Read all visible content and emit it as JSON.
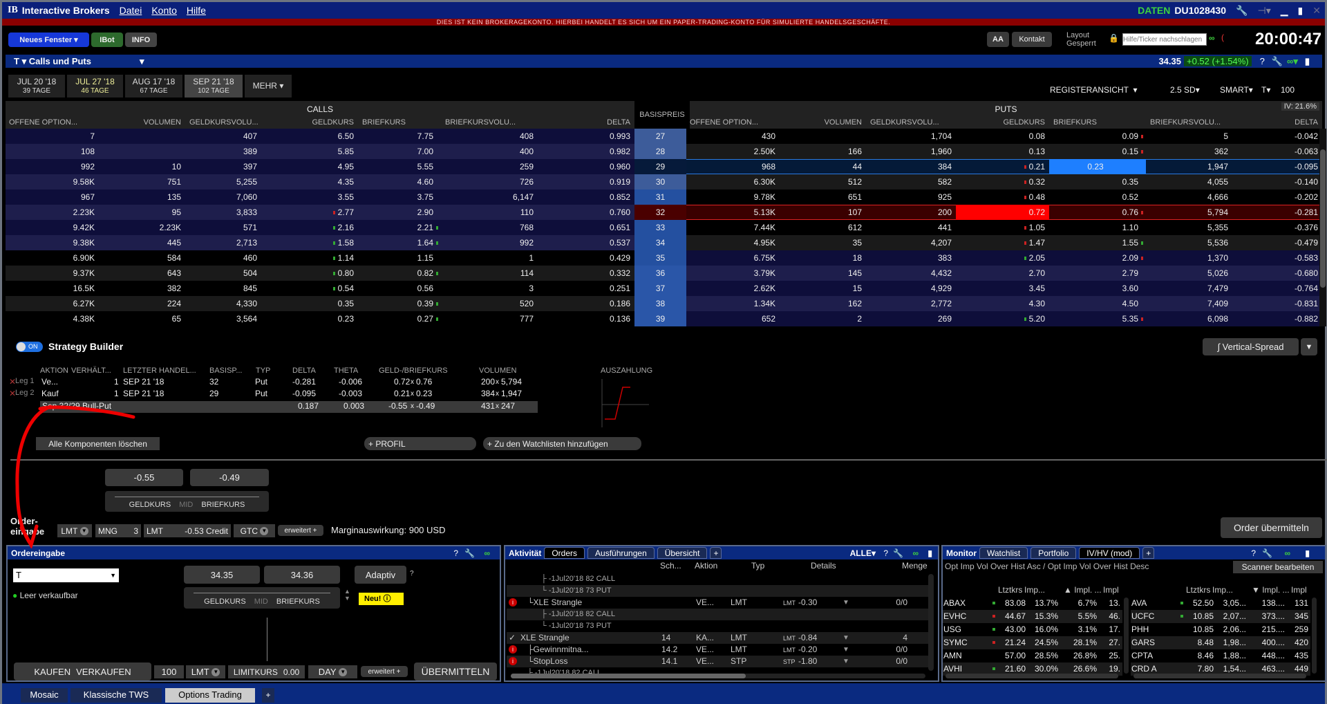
{
  "app": {
    "logo": "IB",
    "title": "Interactive Brokers",
    "menu": [
      "Datei",
      "Konto",
      "Hilfe"
    ],
    "data_label": "DATEN",
    "account": "DU1028430"
  },
  "banner": "DIES IST KEIN BROKERAGEKONTO. HIERBEI HANDELT ES SICH UM EIN PAPER-TRADING-KONTO FÜR SIMULIERTE HANDELSGESCHÄFTE.",
  "toolbar": {
    "new_window": "Neues Fenster",
    "ibot": "IBot",
    "info": "INFO",
    "font_size": "AA",
    "contact": "Kontakt",
    "layout_locked": [
      "Layout",
      "Gesperrt"
    ],
    "search_placeholder": "Hilfe/Ticker nachschlagen",
    "clock": "20:00:47"
  },
  "chain": {
    "ticker": "T",
    "title": "Calls und Puts",
    "last": "34.35",
    "change": "+0.52 (+1.54%)",
    "expiries": [
      {
        "date": "JUL 20 '18",
        "days": "39 TAGE"
      },
      {
        "date": "JUL 27 '18",
        "days": "46 TAGE"
      },
      {
        "date": "AUG 17 '18",
        "days": "67 TAGE"
      },
      {
        "date": "SEP 21 '18",
        "days": "102 TAGE"
      }
    ],
    "more": "MEHR",
    "view": "REGISTERANSICHT",
    "range": "2.5 SD",
    "exchange": "SMART",
    "underlying": "T",
    "multiplier": "100",
    "iv": "IV: 21.6%",
    "calls_label": "CALLS",
    "puts_label": "PUTS",
    "strike_label": "BASISPREIS",
    "columns": [
      "OFFENE OPTION...",
      "VOLUMEN",
      "GELDKURSVOLU...",
      "GELDKURS",
      "BRIEFKURS",
      "BRIEFKURSVOLU...",
      "DELTA"
    ],
    "rows": [
      {
        "strike": "27",
        "call": [
          "7",
          "",
          "407",
          "6.50",
          "7.75",
          "408",
          "0.993"
        ],
        "put": [
          "430",
          "",
          "1,704",
          "0.08",
          "0.09",
          "5",
          "-0.042"
        ],
        "pm": [
          "",
          "red"
        ]
      },
      {
        "strike": "28",
        "call": [
          "108",
          "",
          "389",
          "5.85",
          "7.00",
          "400",
          "0.982"
        ],
        "put": [
          "2.50K",
          "166",
          "1,960",
          "0.13",
          "0.15",
          "362",
          "-0.063"
        ],
        "pm": [
          "",
          "red"
        ]
      },
      {
        "strike": "29",
        "call": [
          "992",
          "10",
          "397",
          "4.95",
          "5.55",
          "259",
          "0.960"
        ],
        "put": [
          "968",
          "44",
          "384",
          "0.21",
          "0.23",
          "1,947",
          "-0.095"
        ],
        "pm": [
          "red",
          ""
        ],
        "hl": "leg2"
      },
      {
        "strike": "30",
        "call": [
          "9.58K",
          "751",
          "5,255",
          "4.35",
          "4.60",
          "726",
          "0.919"
        ],
        "put": [
          "6.30K",
          "512",
          "582",
          "0.32",
          "0.35",
          "4,055",
          "-0.140"
        ],
        "pm": [
          "red",
          ""
        ]
      },
      {
        "strike": "31",
        "call": [
          "967",
          "135",
          "7,060",
          "3.55",
          "3.75",
          "6,147",
          "0.852"
        ],
        "put": [
          "9.78K",
          "651",
          "925",
          "0.48",
          "0.52",
          "4,666",
          "-0.202"
        ],
        "pm": [
          "red",
          ""
        ]
      },
      {
        "strike": "32",
        "call": [
          "2.23K",
          "95",
          "3,833",
          "2.77",
          "2.90",
          "110",
          "0.760"
        ],
        "put": [
          "5.13K",
          "107",
          "200",
          "0.72",
          "0.76",
          "5,794",
          "-0.281"
        ],
        "cm": [
          "red",
          ""
        ],
        "pm": [
          "",
          "red"
        ],
        "hl": "leg1"
      },
      {
        "strike": "33",
        "call": [
          "9.42K",
          "2.23K",
          "571",
          "2.16",
          "2.21",
          "768",
          "0.651"
        ],
        "put": [
          "7.44K",
          "612",
          "441",
          "1.05",
          "1.10",
          "5,355",
          "-0.376"
        ],
        "cm": [
          "green",
          "green"
        ],
        "pm": [
          "red",
          ""
        ]
      },
      {
        "strike": "34",
        "call": [
          "9.38K",
          "445",
          "2,713",
          "1.58",
          "1.64",
          "992",
          "0.537"
        ],
        "put": [
          "4.95K",
          "35",
          "4,207",
          "1.47",
          "1.55",
          "5,536",
          "-0.479"
        ],
        "cm": [
          "green",
          "green"
        ],
        "pm": [
          "red",
          "green"
        ]
      },
      {
        "strike": "35",
        "call": [
          "6.90K",
          "584",
          "460",
          "1.14",
          "1.15",
          "1",
          "0.429"
        ],
        "put": [
          "6.75K",
          "18",
          "383",
          "2.05",
          "2.09",
          "1,370",
          "-0.583"
        ],
        "cm": [
          "green",
          ""
        ],
        "pm": [
          "green",
          "red"
        ]
      },
      {
        "strike": "36",
        "call": [
          "9.37K",
          "643",
          "504",
          "0.80",
          "0.82",
          "114",
          "0.332"
        ],
        "put": [
          "3.79K",
          "145",
          "4,432",
          "2.70",
          "2.79",
          "5,026",
          "-0.680"
        ],
        "cm": [
          "green",
          "green"
        ]
      },
      {
        "strike": "37",
        "call": [
          "16.5K",
          "382",
          "845",
          "0.54",
          "0.56",
          "3",
          "0.251"
        ],
        "put": [
          "2.62K",
          "15",
          "4,929",
          "3.45",
          "3.60",
          "7,479",
          "-0.764"
        ],
        "cm": [
          "green",
          ""
        ]
      },
      {
        "strike": "38",
        "call": [
          "6.27K",
          "224",
          "4,330",
          "0.35",
          "0.39",
          "520",
          "0.186"
        ],
        "put": [
          "1.34K",
          "162",
          "2,772",
          "4.30",
          "4.50",
          "7,409",
          "-0.831"
        ],
        "cm": [
          "",
          "green"
        ]
      },
      {
        "strike": "39",
        "call": [
          "4.38K",
          "65",
          "3,564",
          "0.23",
          "0.27",
          "777",
          "0.136"
        ],
        "put": [
          "652",
          "2",
          "269",
          "5.20",
          "5.35",
          "6,098",
          "-0.882"
        ],
        "cm": [
          "",
          "green"
        ],
        "pm": [
          "green",
          "red"
        ]
      }
    ]
  },
  "strategy": {
    "toggle": "ON",
    "title": "Strategy Builder",
    "strategy_button": "Vertical-Spread",
    "headers": [
      "AKTION",
      "VERHÄLT...",
      "LETZTER HANDEL...",
      "BASISP...",
      "TYP",
      "DELTA",
      "THETA",
      "GELD-/BRIEFKURS",
      "VOLUMEN"
    ],
    "payoff_label": "AUSZAHLUNG",
    "legs": [
      {
        "leg": "Leg 1",
        "action": "Ve...",
        "ratio": "1",
        "expiry": "SEP 21 '18",
        "strike": "32",
        "type": "Put",
        "delta": "-0.281",
        "theta": "-0.006",
        "bid": "0.72",
        "ask": "0.76",
        "vbid": "200",
        "vask": "5,794"
      },
      {
        "leg": "Leg 2",
        "action": "Kauf",
        "ratio": "1",
        "expiry": "SEP 21 '18",
        "strike": "29",
        "type": "Put",
        "delta": "-0.095",
        "theta": "-0.003",
        "bid": "0.21",
        "ask": "0.23",
        "vbid": "384",
        "vask": "1,947"
      }
    ],
    "combo": {
      "name": "Sep 32/29 Bull-Put",
      "delta": "0.187",
      "theta": "0.003",
      "bid": "-0.55",
      "ask": "-0.49",
      "vbid": "431",
      "vask": "247"
    },
    "clear": "Alle Komponenten löschen",
    "profile": "PROFIL",
    "watchlist": "Zu den Watchlisten hinzufügen",
    "bid_price": "-0.55",
    "ask_price": "-0.49",
    "slider": [
      "GELDKURS",
      "MID",
      "BRIEFKURS"
    ],
    "order_label": [
      "Order-",
      "eingabe"
    ],
    "order_type": "LMT",
    "qty_label": "MNG",
    "qty": "3",
    "limit_label": "LMT",
    "limit": "-0.53 Credit",
    "tif": "GTC",
    "advanced": "erweitert",
    "margin": "Marginauswirkung: 900 USD",
    "submit": "Order übermitteln"
  },
  "order_entry": {
    "title": "Ordereingabe",
    "symbol": "T",
    "shortable": "Leer verkaufbar",
    "bid": "34.35",
    "ask": "34.36",
    "slider": [
      "GELDKURS",
      "MID",
      "BRIEFKURS"
    ],
    "adaptive": "Adaptiv",
    "new_badge": "Neu!",
    "buy": "KAUFEN",
    "sell": "VERKAUFEN",
    "qty": "100",
    "type": "LMT",
    "limit_label": "LIMITKURS",
    "limit": "0.00",
    "tif": "DAY",
    "advanced": "erweitert",
    "submit": "ÜBERMITTELN"
  },
  "activity": {
    "title": "Aktivität",
    "tabs": [
      "Orders",
      "Ausführungen",
      "Übersicht"
    ],
    "filter": "ALLE",
    "columns": [
      "Sch...",
      "Aktion",
      "Typ",
      "Details",
      "Menge"
    ],
    "rows": [
      {
        "icon": "",
        "name": "├ -1Jul20'18 82 CALL",
        "indent": 2
      },
      {
        "icon": "",
        "name": "└ -1Jul20'18 73 PUT",
        "indent": 2
      },
      {
        "icon": "info",
        "name": "└XLE Strangle",
        "indent": 1,
        "action": "VE...",
        "type": "LMT",
        "detail_type": "LMT",
        "detail": "-0.30",
        "qty": "0/0"
      },
      {
        "icon": "",
        "name": "├ -1Jul20'18 82 CALL",
        "indent": 2
      },
      {
        "icon": "",
        "name": "└ -1Jul20'18 73 PUT",
        "indent": 2
      },
      {
        "icon": "check",
        "name": "XLE Strangle",
        "indent": 0,
        "sch": "14",
        "action": "KA...",
        "type": "LMT",
        "detail_type": "LMT",
        "detail": "-0.84",
        "qty": "4"
      },
      {
        "icon": "info",
        "name": "├Gewinnmitna...",
        "indent": 1,
        "sch": "14.2",
        "action": "VE...",
        "type": "LMT",
        "detail_type": "LMT",
        "detail": "-0.20",
        "qty": "0/0"
      },
      {
        "icon": "info",
        "name": "└StopLoss",
        "indent": 1,
        "sch": "14.1",
        "action": "VE...",
        "type": "STP",
        "detail_type": "STP",
        "detail": "-1.80",
        "qty": "0/0"
      },
      {
        "icon": "",
        "name": "├ -1Jul20'18 82 CALL",
        "indent": 1
      }
    ]
  },
  "monitor": {
    "title": "Monitor",
    "tabs": [
      "Watchlist",
      "Portfolio",
      "IV/HV (mod)"
    ],
    "subtitle": "Opt Imp Vol Over Hist Asc / Opt Imp Vol Over Hist Desc",
    "scanner": "Scanner bearbeiten",
    "columns_left": [
      "Ltztkrs",
      "Imp...",
      "▲ Impl. ...",
      "Impl"
    ],
    "columns_right": [
      "Ltztkrs",
      "Imp...",
      "▼ Impl. ...",
      "Impl"
    ],
    "left": [
      [
        "ABAX",
        "green",
        "83.08",
        "13.7%",
        "6.7%",
        "13."
      ],
      [
        "EVHC",
        "red",
        "44.67",
        "15.3%",
        "5.5%",
        "46."
      ],
      [
        "USG",
        "green",
        "43.00",
        "16.0%",
        "3.1%",
        "17."
      ],
      [
        "SYMC",
        "red",
        "21.24",
        "24.5%",
        "28.1%",
        "27."
      ],
      [
        "AMN",
        "",
        "57.00",
        "28.5%",
        "26.8%",
        "25."
      ],
      [
        "AVHI",
        "green",
        "21.60",
        "30.0%",
        "26.6%",
        "19."
      ]
    ],
    "right": [
      [
        "AVA",
        "green",
        "52.50",
        "3,05...",
        "138....",
        "131"
      ],
      [
        "UCFC",
        "green",
        "10.85",
        "2,07...",
        "373....",
        "345"
      ],
      [
        "PHH",
        "",
        "10.85",
        "2,06...",
        "215....",
        "259"
      ],
      [
        "GARS",
        "",
        "8.48",
        "1,98...",
        "400....",
        "420"
      ],
      [
        "CPTA",
        "",
        "8.46",
        "1,88...",
        "448....",
        "435"
      ],
      [
        "CRD A",
        "",
        "7.80",
        "1,54...",
        "463....",
        "449"
      ]
    ]
  },
  "bottom_tabs": [
    "Mosaic",
    "Klassische TWS",
    "Options Trading"
  ],
  "colors": {
    "title_bar": "#0a1f7a",
    "banner": "#8a0000",
    "accent_green": "#3ed13e",
    "sell_highlight": "#ff0000",
    "buy_highlight": "#1e7fff"
  }
}
